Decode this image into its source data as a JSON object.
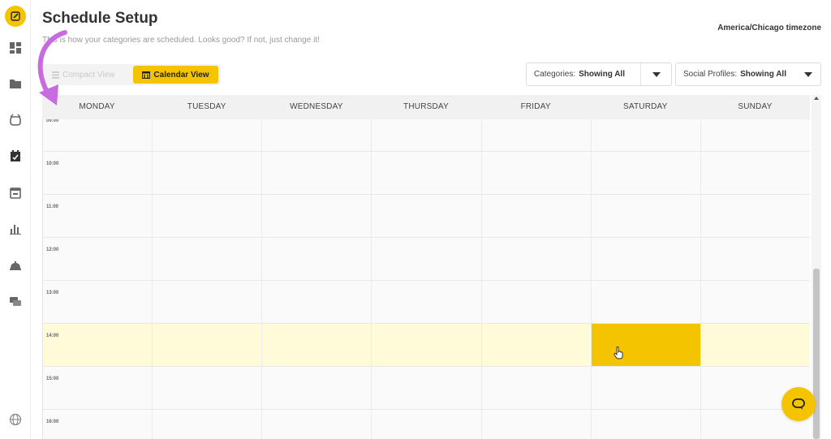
{
  "header": {
    "title": "Schedule Setup",
    "subtitle": "This is how your categories are scheduled. Looks good? If not, just change it!",
    "timezone": "America/Chicago timezone"
  },
  "view_toggle": {
    "compact_label": "Compact View",
    "calendar_label": "Calendar View",
    "selected": "Calendar View"
  },
  "filters": {
    "categories": {
      "label": "Categories:",
      "value": "Showing All"
    },
    "social_profiles": {
      "label": "Social Profiles:",
      "value": "Showing All"
    }
  },
  "calendar": {
    "days": [
      "MONDAY",
      "TUESDAY",
      "WEDNESDAY",
      "THURSDAY",
      "FRIDAY",
      "SATURDAY",
      "SUNDAY"
    ],
    "partial_top_label": "09:00",
    "hours": [
      "10:00",
      "11:00",
      "12:00",
      "13:00",
      "14:00",
      "15:00",
      "16:00"
    ],
    "highlighted_hour": "14:00",
    "active_slot": {
      "day": "SATURDAY",
      "hour": "14:00"
    }
  },
  "sidebar": {
    "items": [
      "edit-icon",
      "dashboard-icon",
      "folder-icon",
      "inbox-icon",
      "calendar-check-icon",
      "calendar-icon",
      "analytics-icon",
      "notification-icon",
      "messages-icon"
    ],
    "footer": "globe-icon"
  },
  "colors": {
    "accent": "#f5c400",
    "highlight_row": "#fffbd9",
    "annotation": "#c86be0"
  }
}
